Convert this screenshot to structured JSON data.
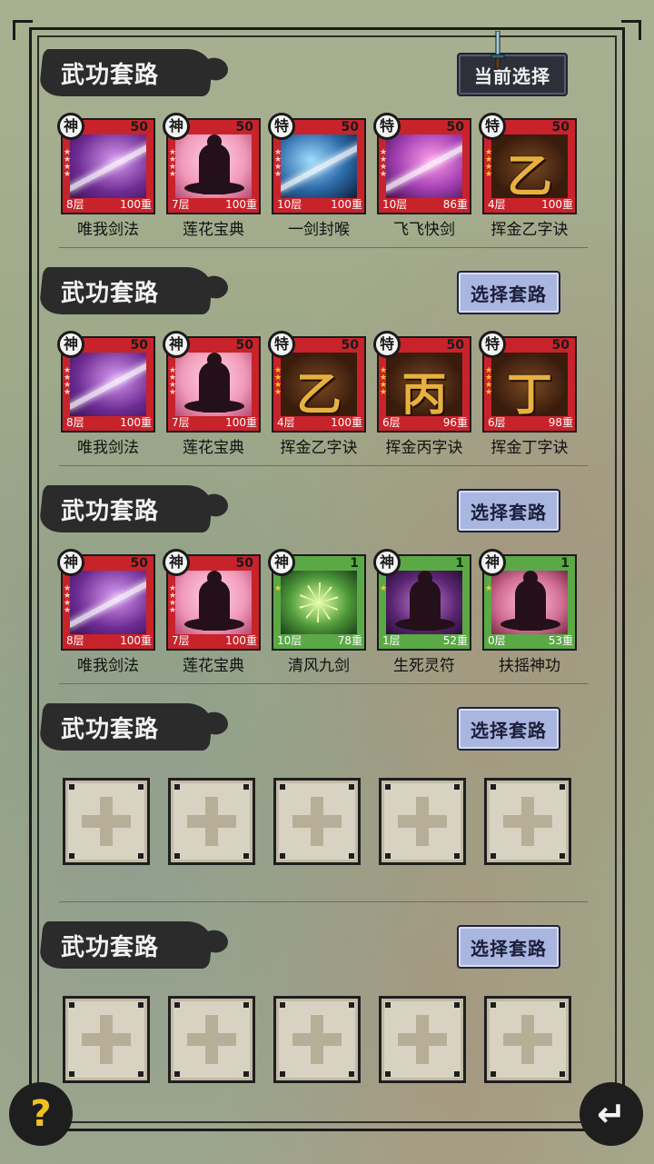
{
  "header": {
    "current_button": "当前选择"
  },
  "action_label": "选择套路",
  "sections": [
    {
      "title": "武功套路",
      "button": "当前选择",
      "skills": [
        {
          "badge": "神",
          "level": "50",
          "layers": "8层",
          "weight": "100重",
          "name": "唯我剑法",
          "card": "red",
          "art": "purple"
        },
        {
          "badge": "神",
          "level": "50",
          "layers": "7层",
          "weight": "100重",
          "name": "莲花宝典",
          "card": "red",
          "art": "pink"
        },
        {
          "badge": "特",
          "level": "50",
          "layers": "10层",
          "weight": "100重",
          "name": "一剑封喉",
          "card": "red",
          "art": "blue"
        },
        {
          "badge": "特",
          "level": "50",
          "layers": "10层",
          "weight": "86重",
          "name": "飞飞快剑",
          "card": "red",
          "art": "magenta"
        },
        {
          "badge": "特",
          "level": "50",
          "layers": "4层",
          "weight": "100重",
          "name": "挥金乙字诀",
          "card": "red",
          "art": "gold",
          "glyph": "乙"
        }
      ]
    },
    {
      "title": "武功套路",
      "button": "选择套路",
      "skills": [
        {
          "badge": "神",
          "level": "50",
          "layers": "8层",
          "weight": "100重",
          "name": "唯我剑法",
          "card": "red",
          "art": "purple"
        },
        {
          "badge": "神",
          "level": "50",
          "layers": "7层",
          "weight": "100重",
          "name": "莲花宝典",
          "card": "red",
          "art": "pink"
        },
        {
          "badge": "特",
          "level": "50",
          "layers": "4层",
          "weight": "100重",
          "name": "挥金乙字诀",
          "card": "red",
          "art": "gold",
          "glyph": "乙"
        },
        {
          "badge": "特",
          "level": "50",
          "layers": "6层",
          "weight": "96重",
          "name": "挥金丙字诀",
          "card": "red",
          "art": "gold",
          "glyph": "丙"
        },
        {
          "badge": "特",
          "level": "50",
          "layers": "6层",
          "weight": "98重",
          "name": "挥金丁字诀",
          "card": "red",
          "art": "gold",
          "glyph": "丁"
        }
      ]
    },
    {
      "title": "武功套路",
      "button": "选择套路",
      "skills": [
        {
          "badge": "神",
          "level": "50",
          "layers": "8层",
          "weight": "100重",
          "name": "唯我剑法",
          "card": "red",
          "art": "purple"
        },
        {
          "badge": "神",
          "level": "50",
          "layers": "7层",
          "weight": "100重",
          "name": "莲花宝典",
          "card": "red",
          "art": "pink"
        },
        {
          "badge": "神",
          "level": "1",
          "layers": "10层",
          "weight": "78重",
          "name": "清风九剑",
          "card": "green",
          "art": "greenburst"
        },
        {
          "badge": "神",
          "level": "1",
          "layers": "1层",
          "weight": "52重",
          "name": "生死灵符",
          "card": "green",
          "art": "violet"
        },
        {
          "badge": "神",
          "level": "1",
          "layers": "0层",
          "weight": "53重",
          "name": "扶摇神功",
          "card": "green",
          "art": "rose"
        }
      ]
    },
    {
      "title": "武功套路",
      "button": "选择套路",
      "skills": []
    },
    {
      "title": "武功套路",
      "button": "选择套路",
      "skills": []
    }
  ],
  "footer": {
    "help": "?",
    "back": "↵"
  },
  "colors": {
    "frame": "#1b1b1b",
    "card_red": "#c8232a",
    "card_green": "#5aa846",
    "button": "#a9b7e0"
  }
}
